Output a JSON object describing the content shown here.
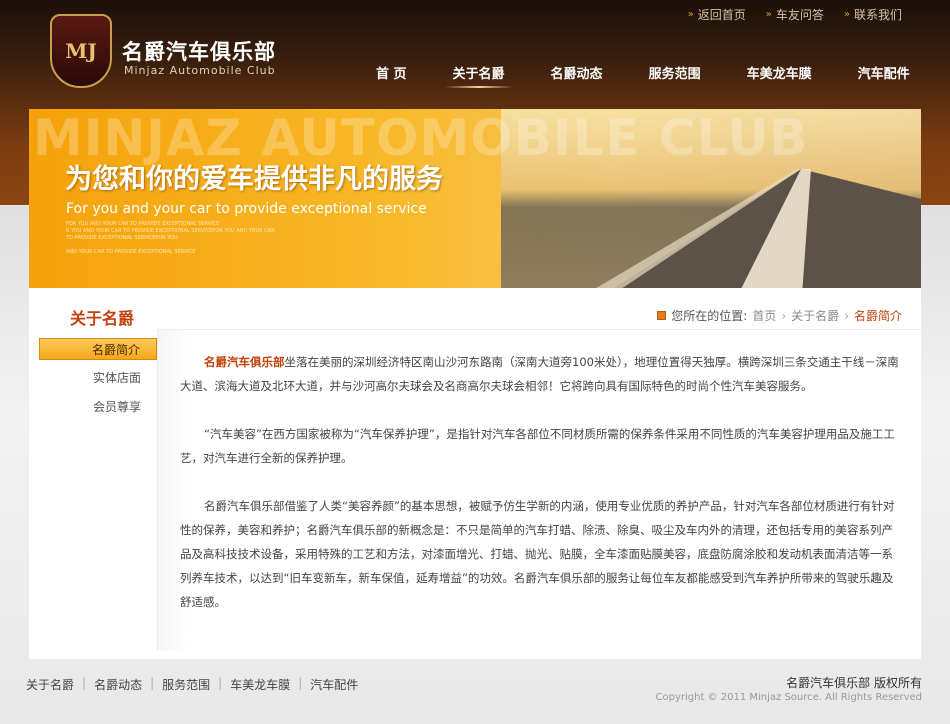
{
  "top_links": [
    "返回首页",
    "车友问答",
    "联系我们"
  ],
  "logo": {
    "badge": "MJ",
    "title": "名爵汽车俱乐部",
    "subtitle": "Minjaz Automobile Club"
  },
  "nav": {
    "items": [
      "首 页",
      "关于名爵",
      "名爵动态",
      "服务范围",
      "车美龙车膜",
      "汽车配件"
    ],
    "active": "关于名爵"
  },
  "banner": {
    "watermark": "MINJAZ AUTOMOBILE CLUB",
    "title": "为您和你的爱车提供非凡的服务",
    "subtitle": "For you and your car to provide exceptional service",
    "small_lines": [
      "FOR YOU AND YOUR CAR TO PROVIDE EXCEPTIONAL SERVICE",
      "R YOU AND YOUR CAR TO PROVIDE EXCEPTIONAL SERVICEFOR YOU AND YOUR CAR",
      "TO PROVIDE EXCEPTIONAL SERVICEFOR YOU",
      "AND YOUR CAR TO PROVIDE EXCEPTIONAL SERVICE"
    ]
  },
  "section": {
    "title": "关于名爵"
  },
  "breadcrumb": {
    "lead": "您所在的位置:",
    "items": [
      "首页",
      "关于名爵"
    ],
    "current": "名爵简介"
  },
  "sidebar": {
    "items": [
      "名爵简介",
      "实体店面",
      "会员尊享"
    ],
    "active": "名爵简介"
  },
  "content": {
    "p1_highlight": "名爵汽车俱乐部",
    "p1_rest": "坐落在美丽的深圳经济特区南山沙河东路南（深南大道旁100米处），地理位置得天独厚。横跨深圳三条交通主干线－深南大道、滨海大道及北环大道，并与沙河高尔夫球会及名商高尔夫球会相邻！它将跨向具有国际特色的时尚个性汽车美容服务。",
    "p2": "“汽车美容”在西方国家被称为“汽车保养护理”，是指针对汽车各部位不同材质所需的保养条件采用不同性质的汽车美容护理用品及施工工艺，对汽车进行全新的保养护理。",
    "p3": "名爵汽车俱乐部借鉴了人类“美容养颜”的基本思想，被赋予仿生学新的内涵，使用专业优质的养护产品，针对汽车各部位材质进行有针对性的保养，美容和养护；名爵汽车俱乐部的新概念是：不只是简单的汽车打蜡、除渍、除臭、吸尘及车内外的清理，还包括专用的美容系列产品及高科技技术设备，采用特殊的工艺和方法，对漆面增光、打蜡、抛光、贴膜，全车漆面贴膜美容，底盘防腐涂胶和发动机表面清洁等一系列养车技术，以达到“旧车变新车，新车保值，延寿增益”的功效。名爵汽车俱乐部的服务让每位车友都能感受到汽车养护所带来的驾驶乐趣及舒适感。"
  },
  "footer": {
    "links": [
      "关于名爵",
      "名爵动态",
      "服务范围",
      "车美龙车膜",
      "汽车配件"
    ],
    "rights": "名爵汽车俱乐部  版权所有",
    "copyright": "Copyright © 2011 Minjaz Source. All Rights Reserved"
  },
  "colors": {
    "accent": "#c2410c",
    "header": "#3a1f0e",
    "banner": "#f5a20a"
  }
}
